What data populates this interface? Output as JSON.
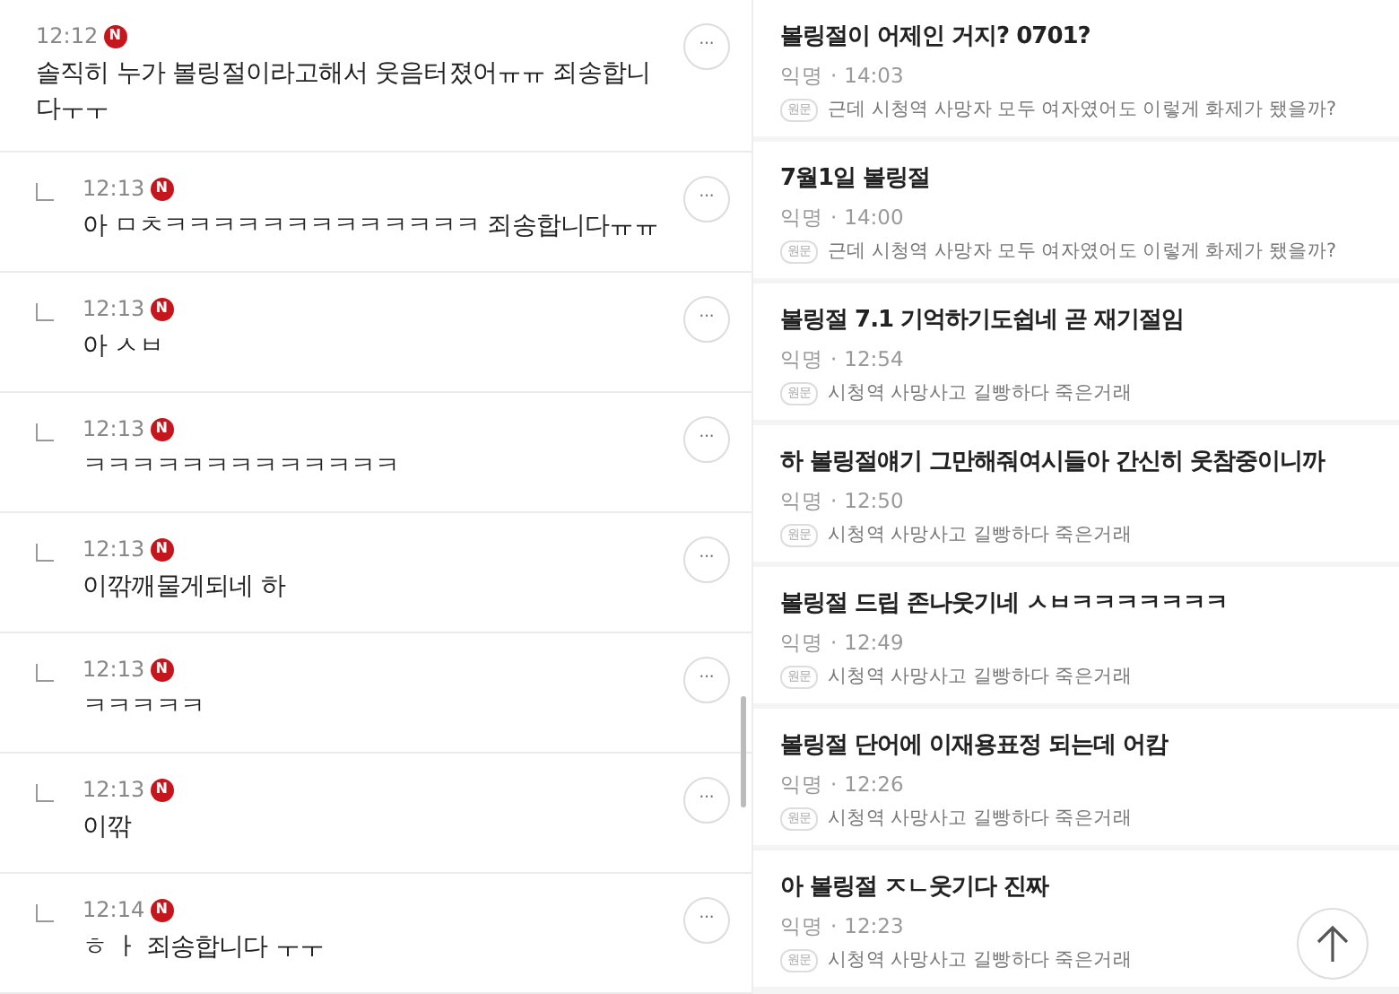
{
  "comments": [
    {
      "kind": "comment",
      "time": "12:12",
      "badge": "N",
      "text": "솔직히 누가 볼링절이라고해서 웃음터졌어ㅠㅠ 죄송합니다ㅜㅜ",
      "more": "···"
    },
    {
      "kind": "reply",
      "time": "12:13",
      "badge": "N",
      "text": "아 ㅁㅊㅋㅋㅋㅋㅋㅋㅋㅋㅋㅋㅋㅋㅋ 죄송합니다ㅠㅠ",
      "more": "···"
    },
    {
      "kind": "reply",
      "time": "12:13",
      "badge": "N",
      "text": "아 ㅅㅂ",
      "more": "···"
    },
    {
      "kind": "reply",
      "time": "12:13",
      "badge": "N",
      "text": "ㅋㅋㅋㅋㅋㅋㅋㅋㅋㅋㅋㅋㅋ",
      "more": "···"
    },
    {
      "kind": "reply",
      "time": "12:13",
      "badge": "N",
      "text": "이깎깨물게되네 하",
      "more": "···"
    },
    {
      "kind": "reply",
      "time": "12:13",
      "badge": "N",
      "text": "ㅋㅋㅋㅋㅋ",
      "more": "···"
    },
    {
      "kind": "reply",
      "time": "12:13",
      "badge": "N",
      "text": "이깎",
      "more": "···"
    },
    {
      "kind": "reply",
      "time": "12:14",
      "badge": "N",
      "text": "ㅎ ㅏ 죄송합니다 ㅜㅜ",
      "more": "···"
    }
  ],
  "posts": [
    {
      "title": "볼링절이 어제인 거지? 0701?",
      "author": "익명",
      "sep": "·",
      "time": "14:03",
      "tag": "원문",
      "source": "근데 시청역 사망자 모두 여자였어도 이렇게 화제가 됐을까?"
    },
    {
      "title": "7월1일 볼링절",
      "author": "익명",
      "sep": "·",
      "time": "14:00",
      "tag": "원문",
      "source": "근데 시청역 사망자 모두 여자였어도 이렇게 화제가 됐을까?"
    },
    {
      "title": "볼링절 7.1 기억하기도쉽네 곧 재기절임",
      "author": "익명",
      "sep": "·",
      "time": "12:54",
      "tag": "원문",
      "source": "시청역 사망사고 길빵하다 죽은거래"
    },
    {
      "title": "하 볼링절얘기 그만해줘여시들아 간신히 웃참중이니까",
      "author": "익명",
      "sep": "·",
      "time": "12:50",
      "tag": "원문",
      "source": "시청역 사망사고 길빵하다 죽은거래"
    },
    {
      "title": "볼링절 드립 존나웃기네 ㅅㅂㅋㅋㅋㅋㅋㅋㅋ",
      "author": "익명",
      "sep": "·",
      "time": "12:49",
      "tag": "원문",
      "source": "시청역 사망사고 길빵하다 죽은거래"
    },
    {
      "title": "볼링절 단어에 이재용표정 되는데 어캄",
      "author": "익명",
      "sep": "·",
      "time": "12:26",
      "tag": "원문",
      "source": "시청역 사망사고 길빵하다 죽은거래"
    },
    {
      "title": "아 볼링절 ㅈㄴ웃기다 진짜",
      "author": "익명",
      "sep": "·",
      "time": "12:23",
      "tag": "원문",
      "source": "시청역 사망사고 길빵하다 죽은거래"
    }
  ]
}
